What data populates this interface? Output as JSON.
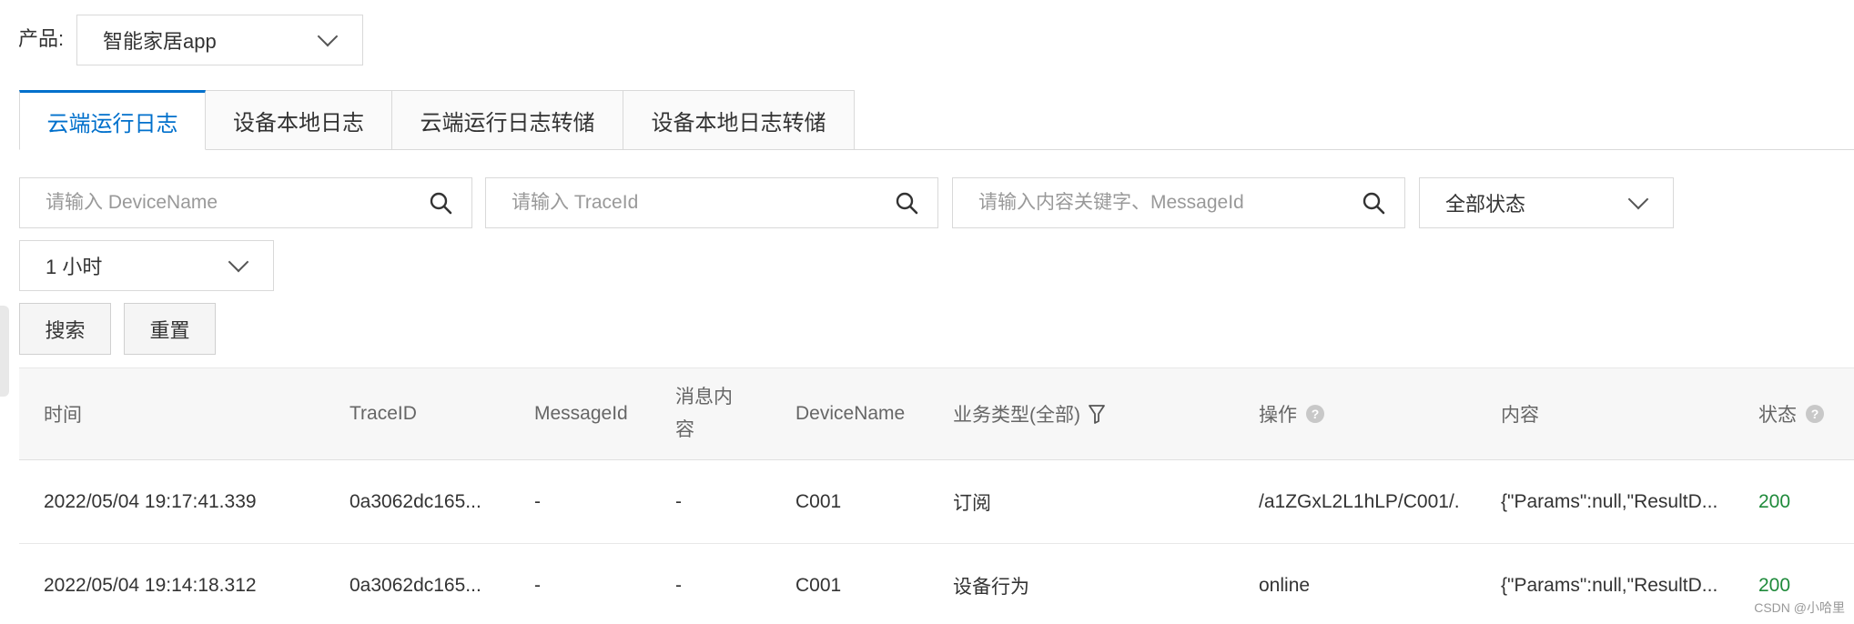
{
  "product": {
    "label": "产品:",
    "selected": "智能家居app"
  },
  "tabs": [
    {
      "label": "云端运行日志",
      "active": true
    },
    {
      "label": "设备本地日志",
      "active": false
    },
    {
      "label": "云端运行日志转储",
      "active": false
    },
    {
      "label": "设备本地日志转储",
      "active": false
    }
  ],
  "filters": {
    "device_placeholder": "请输入 DeviceName",
    "trace_placeholder": "请输入 TraceId",
    "content_placeholder": "请输入内容关键字、MessageId",
    "status_selected": "全部状态",
    "time_selected": "1 小时",
    "search_label": "搜索",
    "reset_label": "重置"
  },
  "table": {
    "headers": {
      "time": "时间",
      "trace": "TraceID",
      "message": "MessageId",
      "msg_content_1": "消息内",
      "msg_content_2": "容",
      "device": "DeviceName",
      "biz": "业务类型(全部)",
      "op": "操作",
      "content": "内容",
      "status": "状态"
    },
    "rows": [
      {
        "time": "2022/05/04 19:17:41.339",
        "trace": "0a3062dc165...",
        "message": "-",
        "msg_content": "-",
        "device": "C001",
        "biz": "订阅",
        "op": "/a1ZGxL2L1hLP/C001/...",
        "content": "{\"Params\":null,\"ResultD...",
        "status": "200"
      },
      {
        "time": "2022/05/04 19:14:18.312",
        "trace": "0a3062dc165...",
        "message": "-",
        "msg_content": "-",
        "device": "C001",
        "biz": "设备行为",
        "op": "online",
        "content": "{\"Params\":null,\"ResultD...",
        "status": "200"
      }
    ]
  },
  "watermark": "CSDN @小哈里",
  "colors": {
    "accent": "#0070cc",
    "status_ok": "#1f8a3b",
    "border": "#d9d9d9"
  }
}
